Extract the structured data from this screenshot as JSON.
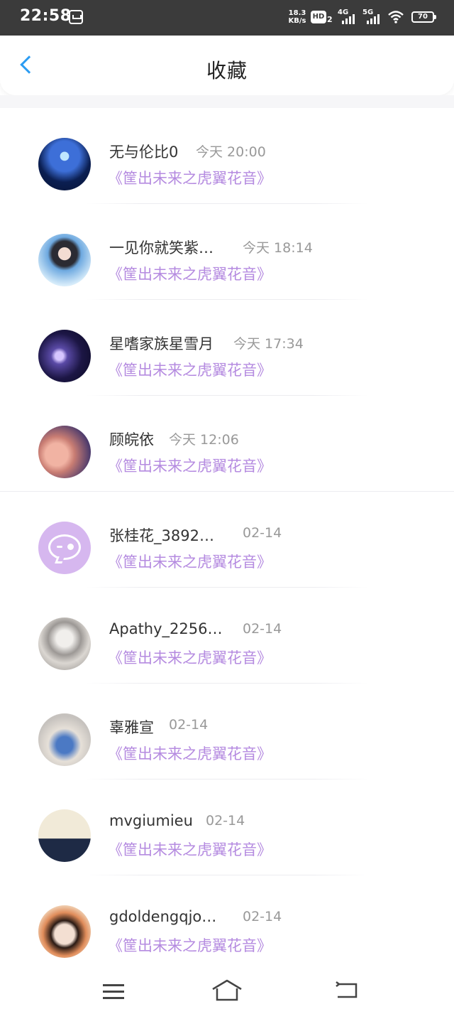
{
  "status_bar": {
    "time": "22:58",
    "net_speed_value": "18.3",
    "net_speed_unit": "KB/s",
    "hd_label": "HD",
    "hd_sub": "2",
    "sig1_label": "4G",
    "sig2_label": "5G",
    "battery": "70"
  },
  "header": {
    "title": "收藏"
  },
  "items": [
    {
      "username": "无与伦比0",
      "time": "今天  20:00",
      "book": "《筐出未来之虎翼花音》"
    },
    {
      "username": "一见你就笑紫…",
      "time": "今天  18:14",
      "book": "《筐出未来之虎翼花音》"
    },
    {
      "username": "星嗜家族星雪月",
      "time": "今天  17:34",
      "book": "《筐出未来之虎翼花音》"
    },
    {
      "username": "顾皖依",
      "time": "今天  12:06",
      "book": "《筐出未来之虎翼花音》"
    },
    {
      "username": "张桂花_3892…",
      "time": "02-14",
      "book": "《筐出未来之虎翼花音》"
    },
    {
      "username": "Apathy_2256…",
      "time": "02-14",
      "book": "《筐出未来之虎翼花音》"
    },
    {
      "username": "辜雅宣",
      "time": "02-14",
      "book": "《筐出未来之虎翼花音》"
    },
    {
      "username": "mvgiumieu",
      "time": "02-14",
      "book": "《筐出未来之虎翼花音》"
    },
    {
      "username": "gdoldengqjo…",
      "time": "02-14",
      "book": "《筐出未来之虎翼花音》"
    }
  ],
  "colors": {
    "accent_blue": "#2b9cf2",
    "book_title_purple": "#b58be0",
    "status_bar_bg": "#3b3b3b"
  },
  "icons": [
    "back-arrow-icon",
    "menu-icon",
    "home-icon",
    "back-nav-icon",
    "wifi-icon",
    "chat-bubble-icon"
  ]
}
